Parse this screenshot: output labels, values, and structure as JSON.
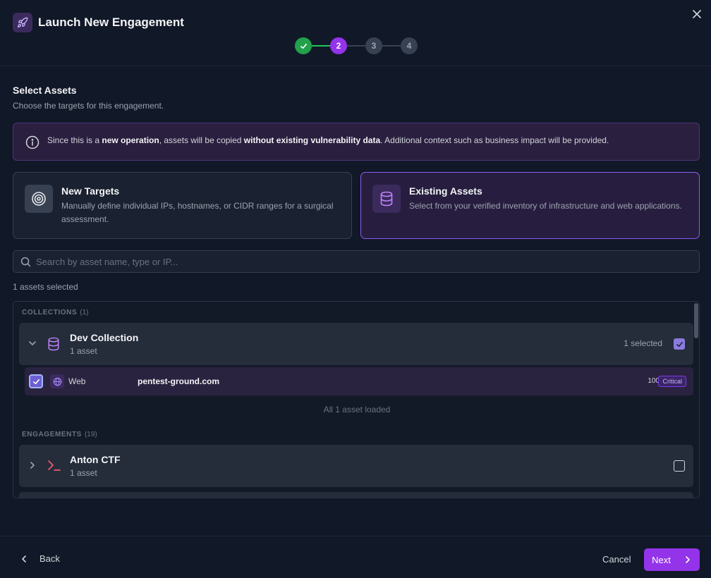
{
  "header": {
    "title": "Launch New Engagement",
    "icon": "rocket-icon"
  },
  "stepper": {
    "steps": [
      {
        "label": "✓",
        "state": "done"
      },
      {
        "label": "2",
        "state": "active"
      },
      {
        "label": "3",
        "state": "todo"
      },
      {
        "label": "4",
        "state": "todo"
      }
    ]
  },
  "section": {
    "title": "Select Assets",
    "subtitle": "Choose the targets for this engagement."
  },
  "info": {
    "part1": "Since this is a ",
    "bold1": "new operation",
    "part2": ", assets will be copied ",
    "bold2": "without existing vulnerability data",
    "part3": ". Additional context such as business impact will be provided."
  },
  "options": {
    "new_targets": {
      "title": "New Targets",
      "desc": "Manually define individual IPs, hostnames, or CIDR ranges for a surgical assessment."
    },
    "existing_assets": {
      "title": "Existing Assets",
      "desc": "Select from your verified inventory of infrastructure and web applications."
    }
  },
  "search": {
    "placeholder": "Search by asset name, type or IP..."
  },
  "selection": {
    "count_text": "1 assets selected"
  },
  "collections": {
    "label": "COLLECTIONS",
    "count": "(1)",
    "group": {
      "title": "Dev Collection",
      "subtitle": "1 asset",
      "selected_text": "1 selected"
    },
    "asset": {
      "type": "Web",
      "name": "pentest-ground.com",
      "score": "100",
      "severity": "Critical"
    },
    "loaded_text": "All 1 asset loaded"
  },
  "engagements": {
    "label": "ENGAGEMENTS",
    "count": "(19)",
    "group": {
      "title": "Anton CTF",
      "subtitle": "1 asset"
    }
  },
  "footer": {
    "back_label": "Back",
    "cancel_label": "Cancel",
    "next_label": "Next"
  },
  "colors": {
    "accent": "#9333ea",
    "success": "#22a04b",
    "background": "#111827"
  }
}
